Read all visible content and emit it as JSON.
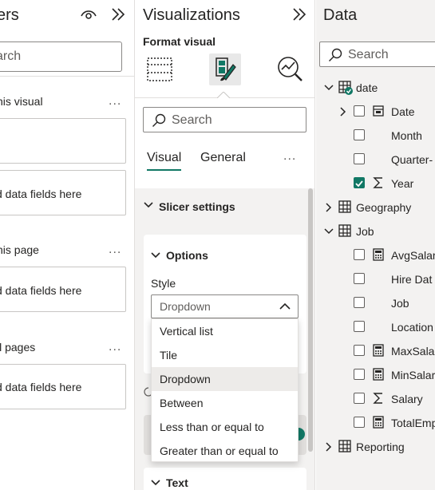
{
  "filters": {
    "title": "ers",
    "search_placeholder": "arch",
    "sections": [
      {
        "label": "his visual",
        "more": "...",
        "well_text": ""
      },
      {
        "label": "",
        "more": "",
        "well_text": "d data fields here"
      },
      {
        "label": "his page",
        "more": "...",
        "well_text": "d data fields here"
      },
      {
        "label": "ll pages",
        "more": "...",
        "well_text": "d data fields here"
      }
    ]
  },
  "visualizations": {
    "title": "Visualizations",
    "format_visual_label": "Format visual",
    "search_placeholder": "Search",
    "tabs": [
      "Visual",
      "General"
    ],
    "more": "...",
    "slicer_settings_label": "Slicer settings",
    "options_label": "Options",
    "style_label": "Style",
    "dropdown_value": "Dropdown",
    "dropdown_options": [
      "Vertical list",
      "Tile",
      "Dropdown",
      "Between",
      "Less than or equal to",
      "Greater than or equal to"
    ],
    "selected_option": "Dropdown",
    "text_section_label": "Text",
    "accent_color": "#117865"
  },
  "data_pane": {
    "title": "Data",
    "search_placeholder": "Search",
    "tree": [
      {
        "label": "date",
        "level": 0,
        "expanded": true,
        "icon": "table-icon",
        "checked": null
      },
      {
        "label": "Date",
        "level": 1,
        "expandable": true,
        "icon": "calendar-icon",
        "checked": false
      },
      {
        "label": "Month",
        "level": 1,
        "icon": "",
        "checked": false
      },
      {
        "label": "Quarter-",
        "level": 1,
        "icon": "",
        "checked": false
      },
      {
        "label": "Year",
        "level": 1,
        "icon": "sigma-icon",
        "checked": true
      },
      {
        "label": "Geography",
        "level": 0,
        "expanded": false,
        "icon": "table-icon",
        "checked": null
      },
      {
        "label": "Job",
        "level": 0,
        "expanded": true,
        "icon": "table-icon",
        "checked": null
      },
      {
        "label": "AvgSalar",
        "level": 1,
        "icon": "calculator-icon",
        "checked": false
      },
      {
        "label": "Hire Dat",
        "level": 1,
        "icon": "",
        "checked": false
      },
      {
        "label": "Job",
        "level": 1,
        "icon": "",
        "checked": false
      },
      {
        "label": "Location",
        "level": 1,
        "icon": "",
        "checked": false
      },
      {
        "label": "MaxSala",
        "level": 1,
        "icon": "calculator-icon",
        "checked": false
      },
      {
        "label": "MinSalar",
        "level": 1,
        "icon": "calculator-icon",
        "checked": false
      },
      {
        "label": "Salary",
        "level": 1,
        "icon": "sigma-icon",
        "checked": false
      },
      {
        "label": "TotalEmp",
        "level": 1,
        "icon": "calculator-icon",
        "checked": false
      },
      {
        "label": "Reporting",
        "level": 0,
        "expanded": false,
        "icon": "table-icon",
        "checked": null
      }
    ]
  }
}
